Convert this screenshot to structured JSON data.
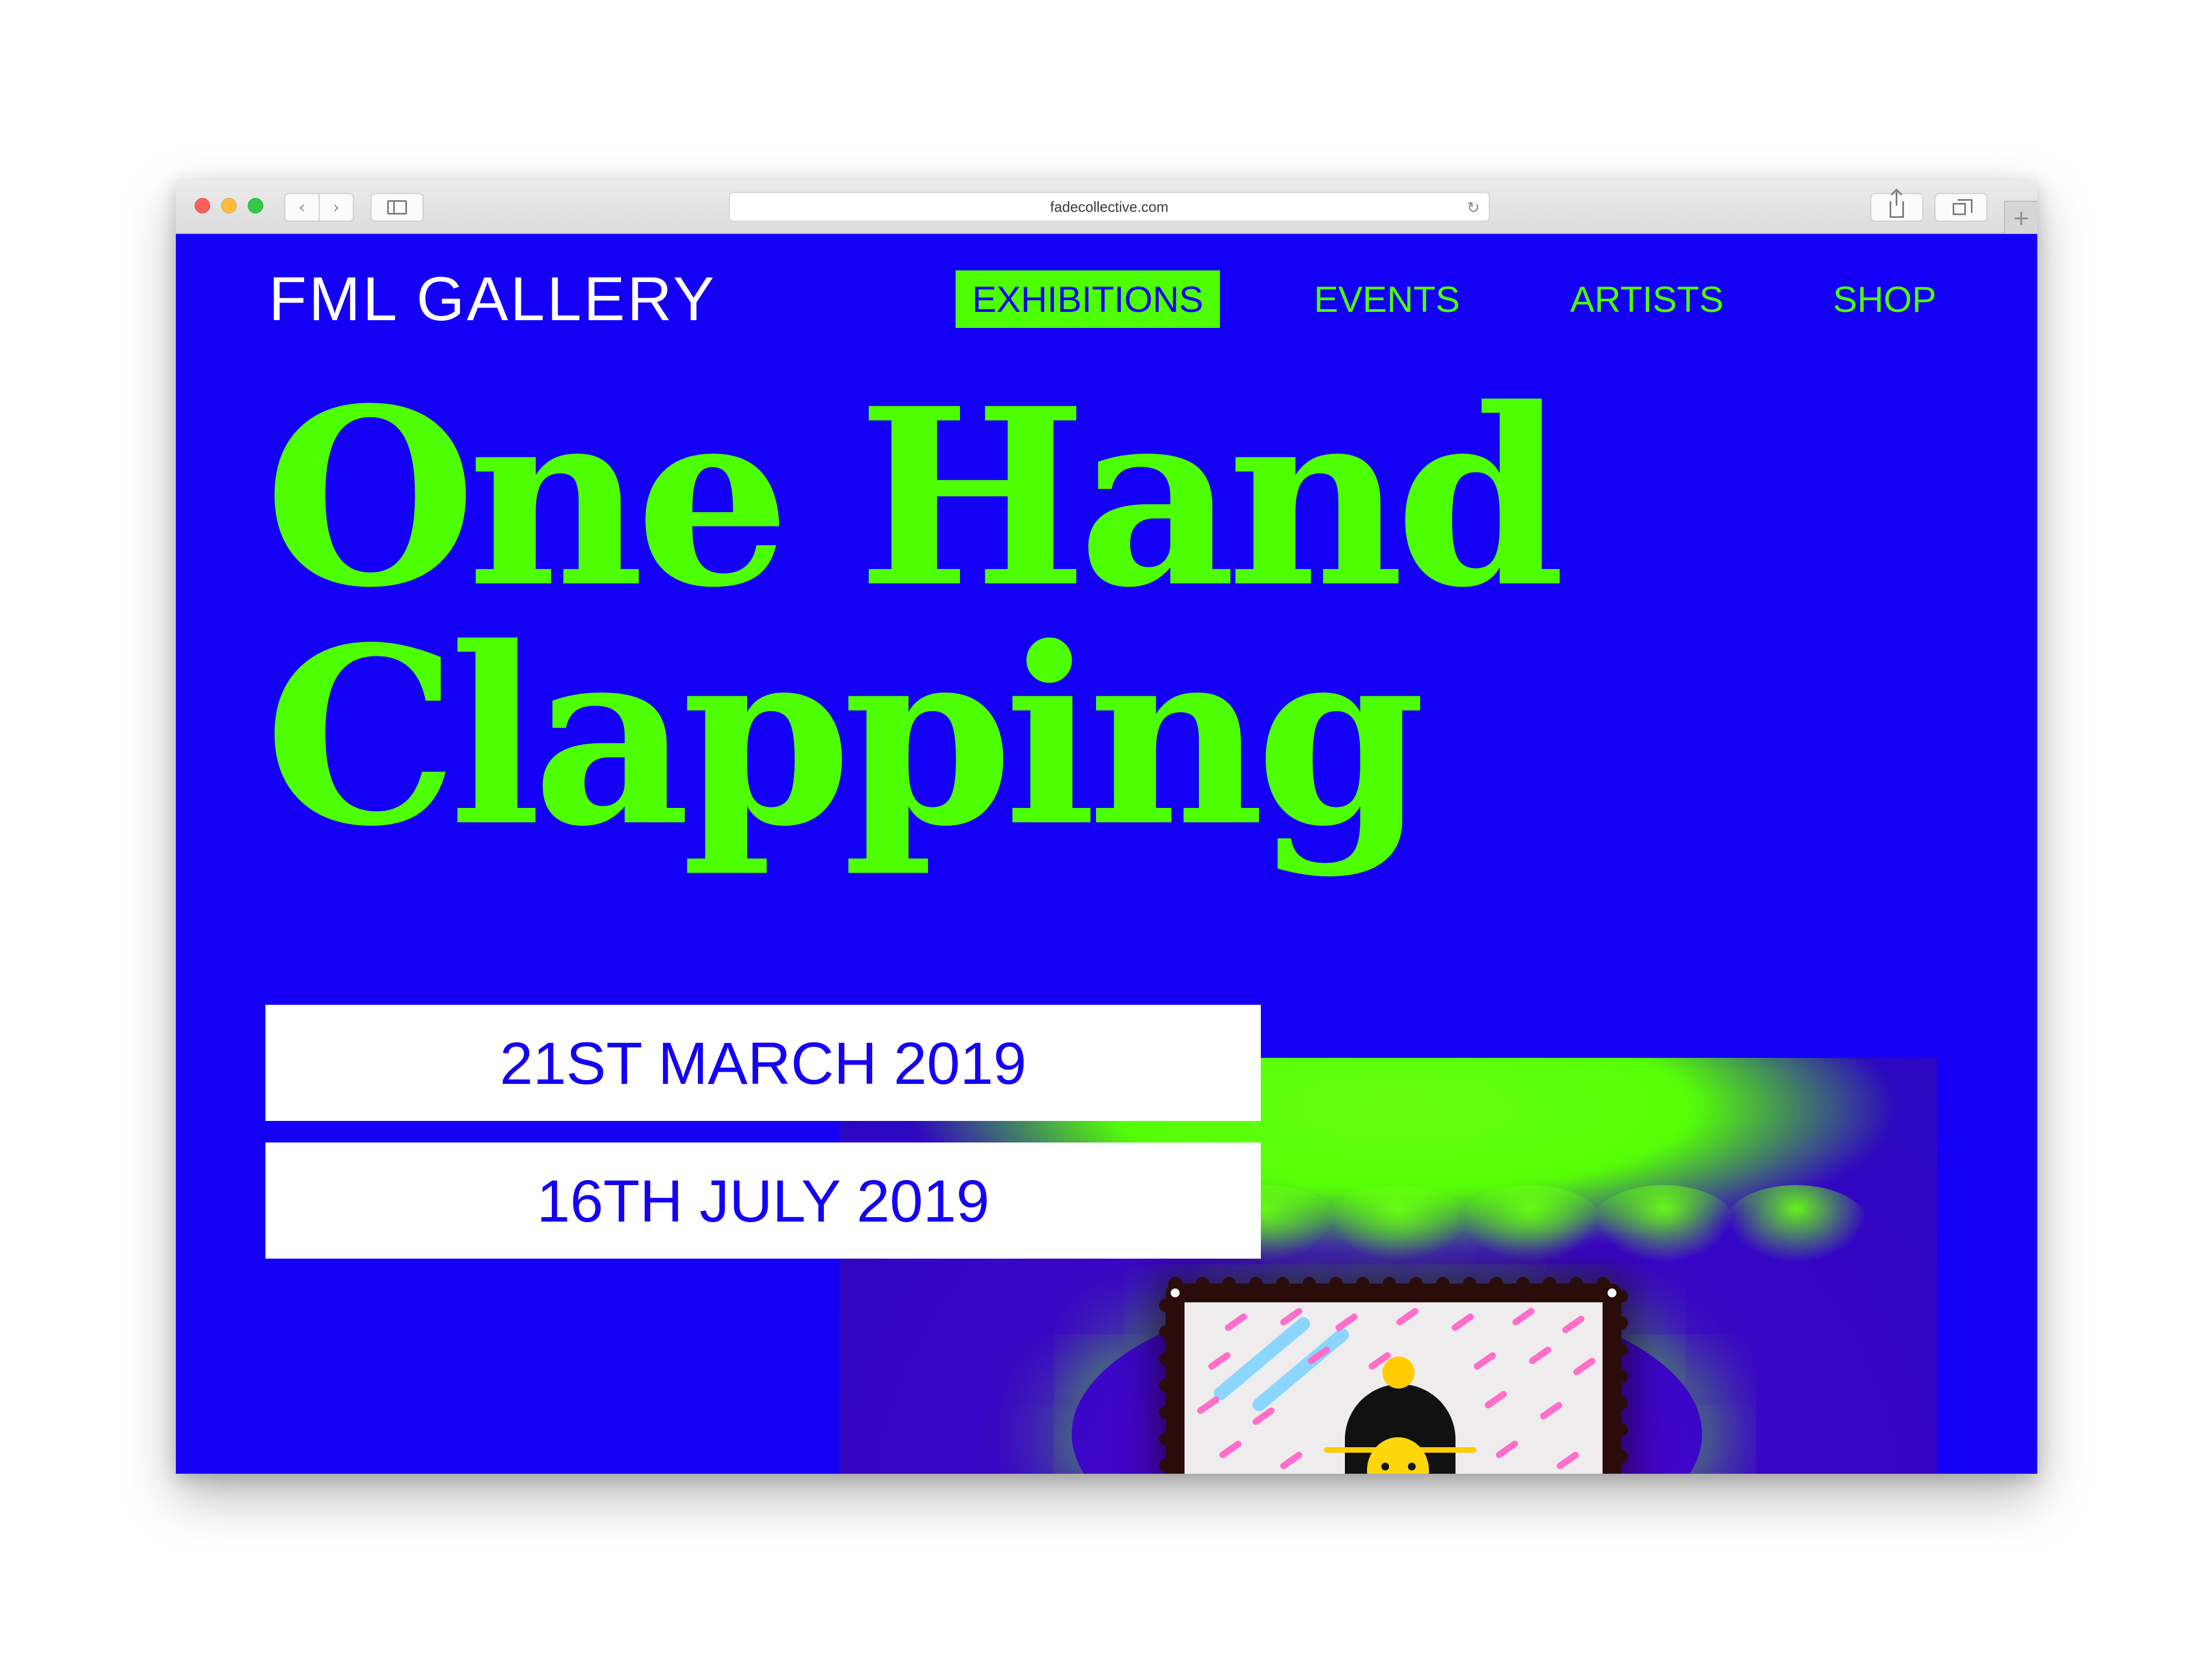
{
  "browser": {
    "url": "fadecollective.com",
    "icons": {
      "back": "chevron-left-icon",
      "forward": "chevron-right-icon",
      "sidebar": "sidebar-icon",
      "reload": "reload-icon",
      "share": "share-icon",
      "tabs": "tabs-icon",
      "new_tab": "plus-icon"
    }
  },
  "site": {
    "logo": "FML GALLERY",
    "nav": [
      {
        "label": "EXHIBITIONS",
        "active": true
      },
      {
        "label": "EVENTS",
        "active": false
      },
      {
        "label": "ARTISTS",
        "active": false
      },
      {
        "label": "SHOP",
        "active": false
      }
    ],
    "headline": [
      "One Hand",
      "Clapping"
    ],
    "dates": {
      "start": "21ST MARCH 2019",
      "end": "16TH JULY 2019"
    }
  },
  "colors": {
    "background": "#1400f5",
    "accent": "#4dff00",
    "text_light": "#ffffff"
  }
}
